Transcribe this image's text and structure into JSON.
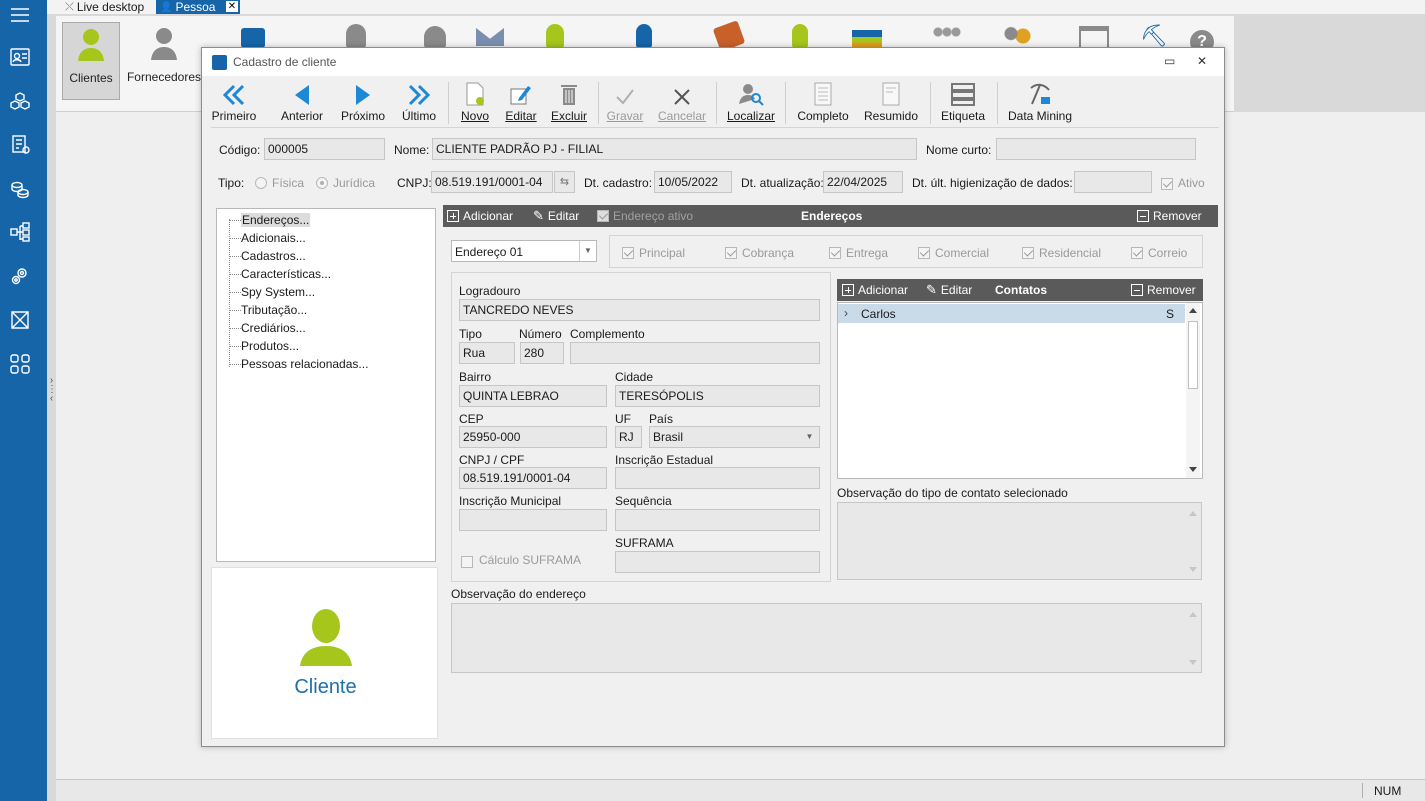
{
  "topbar": {
    "tab_live": "Live desktop",
    "tab_pessoa": "Pessoa",
    "close": "✕"
  },
  "ribbon": {
    "clientes": "Clientes",
    "fornecedores": "Fornecedores"
  },
  "window": {
    "title": "Cadastro de cliente",
    "minimize": "▭",
    "close": "✕"
  },
  "toolbar": {
    "primeiro": "Primeiro",
    "anterior": "Anterior",
    "proximo": "Próximo",
    "ultimo": "Último",
    "novo": "Novo",
    "editar": "Editar",
    "excluir": "Excluir",
    "gravar": "Gravar",
    "cancelar": "Cancelar",
    "localizar": "Localizar",
    "completo": "Completo",
    "resumido": "Resumido",
    "etiqueta": "Etiqueta",
    "data_mining": "Data Mining"
  },
  "header": {
    "codigo_label": "Código:",
    "codigo": "000005",
    "nome_label": "Nome:",
    "nome": "CLIENTE PADRÃO PJ - FILIAL",
    "nome_curto_label": "Nome curto:",
    "nome_curto": "",
    "tipo_label": "Tipo:",
    "fisica": "Física",
    "juridica": "Jurídica",
    "cnpj_label": "CNPJ:",
    "cnpj": "08.519.191/0001-04",
    "dt_cadastro_label": "Dt. cadastro:",
    "dt_cadastro": "10/05/2022",
    "dt_atualizacao_label": "Dt. atualização:",
    "dt_atualizacao": "22/04/2025",
    "dt_higienizacao_label": "Dt. últ. higienização de dados:",
    "dt_higienizacao": "",
    "ativo": "Ativo"
  },
  "tree": {
    "items": [
      "Endereços...",
      "Adicionais...",
      "Cadastros...",
      "Características...",
      "Spy System...",
      "Tributação...",
      "Crediários...",
      "Produtos...",
      "Pessoas relacionadas..."
    ]
  },
  "preview": {
    "label": "Cliente"
  },
  "enderecos": {
    "adicionar": "Adicionar",
    "editar": "Editar",
    "ativo": "Endereço ativo",
    "title": "Endereços",
    "remover": "Remover",
    "selected": "Endereço 01",
    "flags": [
      "Principal",
      "Cobrança",
      "Entrega",
      "Comercial",
      "Residencial",
      "Correio"
    ],
    "logradouro_label": "Logradouro",
    "logradouro": "TANCREDO NEVES",
    "tipo_label": "Tipo",
    "tipo": "Rua",
    "numero_label": "Número",
    "numero": "280",
    "complemento_label": "Complemento",
    "complemento": "",
    "bairro_label": "Bairro",
    "bairro": "QUINTA LEBRAO",
    "cidade_label": "Cidade",
    "cidade": "TERESÓPOLIS",
    "cep_label": "CEP",
    "cep": "25950-000",
    "uf_label": "UF",
    "uf": "RJ",
    "pais_label": "País",
    "pais": "Brasil",
    "cnpj_cpf_label": "CNPJ / CPF",
    "cnpj_cpf": "08.519.191/0001-04",
    "ie_label": "Inscrição Estadual",
    "ie": "",
    "im_label": "Inscrição Municipal",
    "im": "",
    "sequencia_label": "Sequência",
    "sequencia": "",
    "suframa_calc": "Cálculo SUFRAMA",
    "suframa_label": "SUFRAMA",
    "suframa": "",
    "obs_label": "Observação do endereço"
  },
  "contatos": {
    "adicionar": "Adicionar",
    "editar": "Editar",
    "title": "Contatos",
    "remover": "Remover",
    "rows": [
      {
        "name": "Carlos",
        "flag": "S"
      }
    ],
    "obs_label": "Observação do tipo de contato selecionado"
  },
  "status": {
    "num": "NUM"
  },
  "colors": {
    "accent": "#1565a8",
    "header_bar": "#5a5a5a",
    "client_icon": "#a6c61c",
    "cliente_text": "#1e6fa8"
  }
}
